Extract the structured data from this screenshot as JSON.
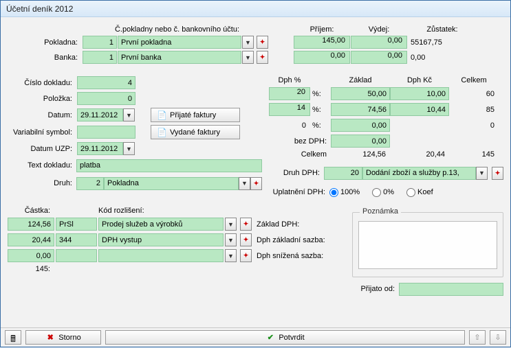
{
  "title": "Účetní deník 2012",
  "labels": {
    "cpokl": "Č.pokladny nebo č. bankovního účtu:",
    "pokladna": "Pokladna:",
    "banka": "Banka:",
    "prijem": "Příjem:",
    "vydej": "Výdej:",
    "zustatek": "Zůstatek:",
    "cislo_dokladu": "Číslo dokladu:",
    "polozka": "Položka:",
    "datum": "Datum:",
    "var_symbol": "Variabilní symbol:",
    "datum_uzp": "Datum UZP:",
    "text_dokladu": "Text dokladu:",
    "druh": "Druh:",
    "prijate_faktury": "Přijaté faktury",
    "vydane_faktury": "Vydané faktury",
    "dph_pct": "Dph %",
    "zaklad": "Základ",
    "dph_kc": "Dph Kč",
    "celkem": "Celkem",
    "bez_dph": "bez DPH:",
    "druh_dph": "Druh DPH:",
    "uplatneni_dph": "Uplatnění DPH:",
    "r100": "100%",
    "r0": "0%",
    "rkoef": "Koef",
    "castka": "Částka:",
    "kod_rozliseni": "Kód rozlišení:",
    "zaklad_dph": "Základ DPH:",
    "dph_zakl_sazba": "Dph základní sazba:",
    "dph_sniz_sazba": "Dph snížená sazba:",
    "poznamka": "Poznámka",
    "prijato_od": "Přijato od:",
    "storno": "Storno",
    "potvrdit": "Potvrdit",
    "pct20": "20",
    "pct14": "14",
    "pct0": "0",
    "sfx_pct": "%:",
    "celkem_row": "Celkem"
  },
  "top": {
    "pokladna_num": "1",
    "pokladna_name": "První pokladna",
    "banka_num": "1",
    "banka_name": "První banka",
    "prijem_pokl": "145,00",
    "vydej_pokl": "0,00",
    "zust_pokl": "55167,75",
    "prijem_bank": "0,00",
    "vydej_bank": "0,00",
    "zust_bank": "0,00"
  },
  "doc": {
    "cislo": "4",
    "polozka": "0",
    "datum": "29.11.2012",
    "vs": "",
    "datum_uzp": "29.11.2012",
    "text": "platba",
    "druh_num": "2",
    "druh_name": "Pokladna"
  },
  "vat": {
    "r20_zaklad": "50,00",
    "r20_dph": "10,00",
    "r20_sum": "60",
    "r14_zaklad": "74,56",
    "r14_dph": "10,44",
    "r14_sum": "85",
    "r0_zaklad": "0,00",
    "r0_sum": "0",
    "bezdph": "0,00",
    "sum_zaklad": "124,56",
    "sum_dph": "20,44",
    "sum_total": "145",
    "druh_dph_num": "20",
    "druh_dph_name": "Dodání zboží a služby p.13,"
  },
  "lines": {
    "a1_castka": "124,56",
    "a1_kod": "PrSl",
    "a1_name": "Prodej služeb a výrobků",
    "a2_castka": "20,44",
    "a2_kod": "344",
    "a2_name": "DPH vystup",
    "a3_castka": "0,00",
    "a3_kod": "",
    "a3_name": "",
    "total": "145:"
  },
  "note": "",
  "prijato_od": ""
}
